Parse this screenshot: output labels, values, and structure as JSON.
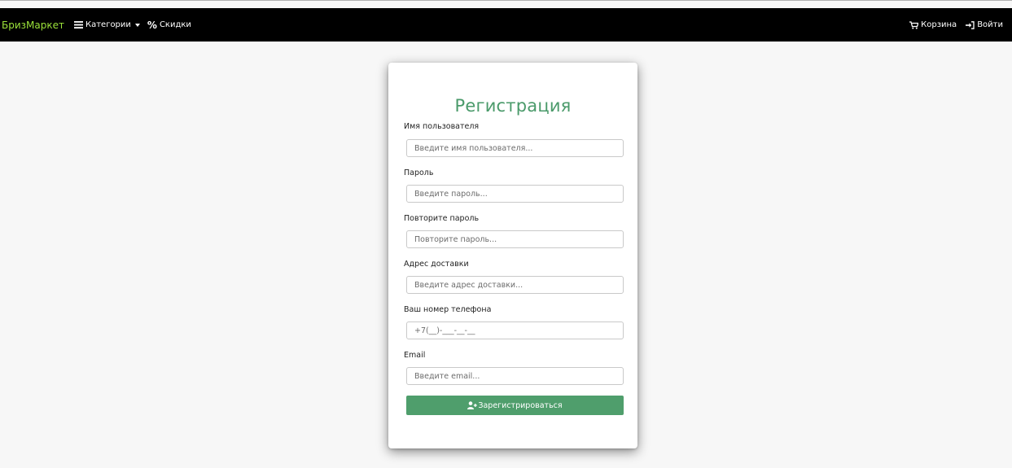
{
  "navbar": {
    "brand": "БризМаркет",
    "categories_label": "Категории",
    "discounts_label": "Скидки",
    "cart_label": "Корзина",
    "login_label": "Войти",
    "icons": [
      "list-icon",
      "caret-down-icon",
      "percent-icon",
      "cart-icon",
      "sign-in-icon"
    ]
  },
  "form": {
    "title": "Регистрация",
    "fields": [
      {
        "label": "Имя пользователя",
        "placeholder": "Введите имя пользователя..."
      },
      {
        "label": "Пароль",
        "placeholder": "Введите пароль..."
      },
      {
        "label": "Повторите пароль",
        "placeholder": "Повторите пароль..."
      },
      {
        "label": "Адрес доставки",
        "placeholder": "Введите адрес доставки..."
      },
      {
        "label": "Ваш номер телефона",
        "placeholder": "+7(__)-___-__-__"
      },
      {
        "label": "Email",
        "placeholder": "Введите email..."
      }
    ],
    "submit_label": "Зарегистрироваться"
  },
  "colors": {
    "navbar_bg": "#000000",
    "brand": "#9be23a",
    "title": "#4a9a6a",
    "button": "#4f9e6c",
    "page_bg": "#f7f7f7"
  }
}
